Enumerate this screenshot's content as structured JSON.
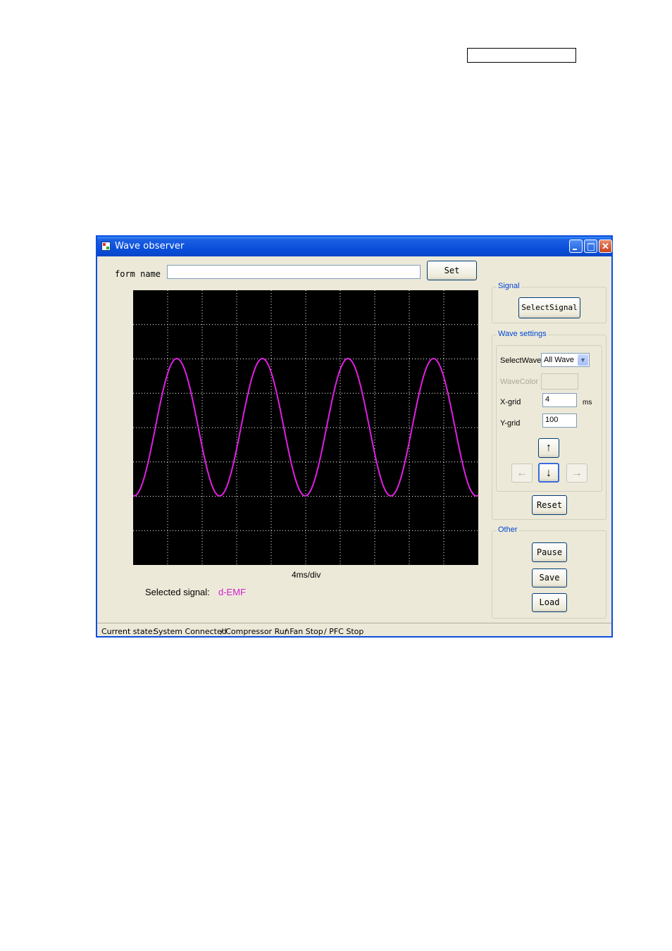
{
  "window": {
    "title": "Wave observer"
  },
  "form": {
    "label": "form name",
    "value": "",
    "set_label": "Set"
  },
  "scope": {
    "x_label": "4ms/div",
    "selected_label": "Selected signal:",
    "selected_value": "d-EMF",
    "colors": {
      "background": "#000000",
      "grid": "#ffffff",
      "wave": "#e020e0"
    }
  },
  "signal_group": {
    "title": "Signal",
    "select_label": "SelectSignal"
  },
  "wave_settings": {
    "title": "Wave settings",
    "select_wave_label": "SelectWave",
    "select_wave_value": "All Wave",
    "wave_color_label": "WaveColor",
    "x_grid_label": "X-grid",
    "x_grid_value": "4",
    "x_grid_unit": "ms",
    "y_grid_label": "Y-grid",
    "y_grid_value": "100",
    "arrows": {
      "up": "↑",
      "down": "↓",
      "left": "←",
      "right": "→"
    },
    "reset_label": "Reset"
  },
  "other_group": {
    "title": "Other",
    "pause_label": "Pause",
    "save_label": "Save",
    "load_label": "Load"
  },
  "status": {
    "label": "Current state:",
    "system": "System Connected",
    "compressor": "/ Compressor Run",
    "fan": "/ Fan Stop",
    "pfc": "/ PFC Stop"
  }
}
